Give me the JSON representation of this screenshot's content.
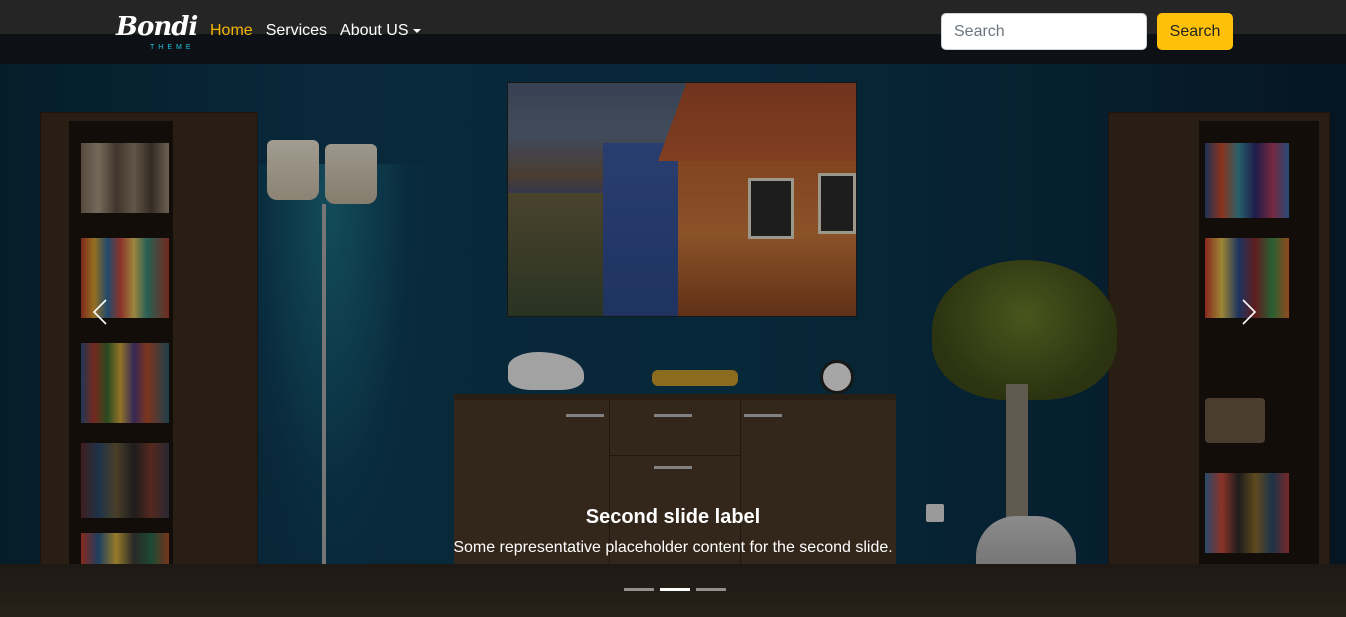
{
  "brand": {
    "name": "Bondi",
    "tagline": "THEME"
  },
  "nav": {
    "items": [
      {
        "label": "Home",
        "active": true
      },
      {
        "label": "Services",
        "active": false
      },
      {
        "label": "About US",
        "active": false,
        "dropdown": true
      }
    ]
  },
  "search": {
    "placeholder": "Search",
    "button_label": "Search"
  },
  "carousel": {
    "caption_title": "Second slide label",
    "caption_text": "Some representative placeholder content for the second slide.",
    "indicators": [
      false,
      true,
      false
    ],
    "prev_icon": "chevron-left-icon",
    "next_icon": "chevron-right-icon"
  },
  "colors": {
    "accent": "#ffc107",
    "active_link": "#f5b400",
    "brand_sub": "#20c9e8"
  }
}
